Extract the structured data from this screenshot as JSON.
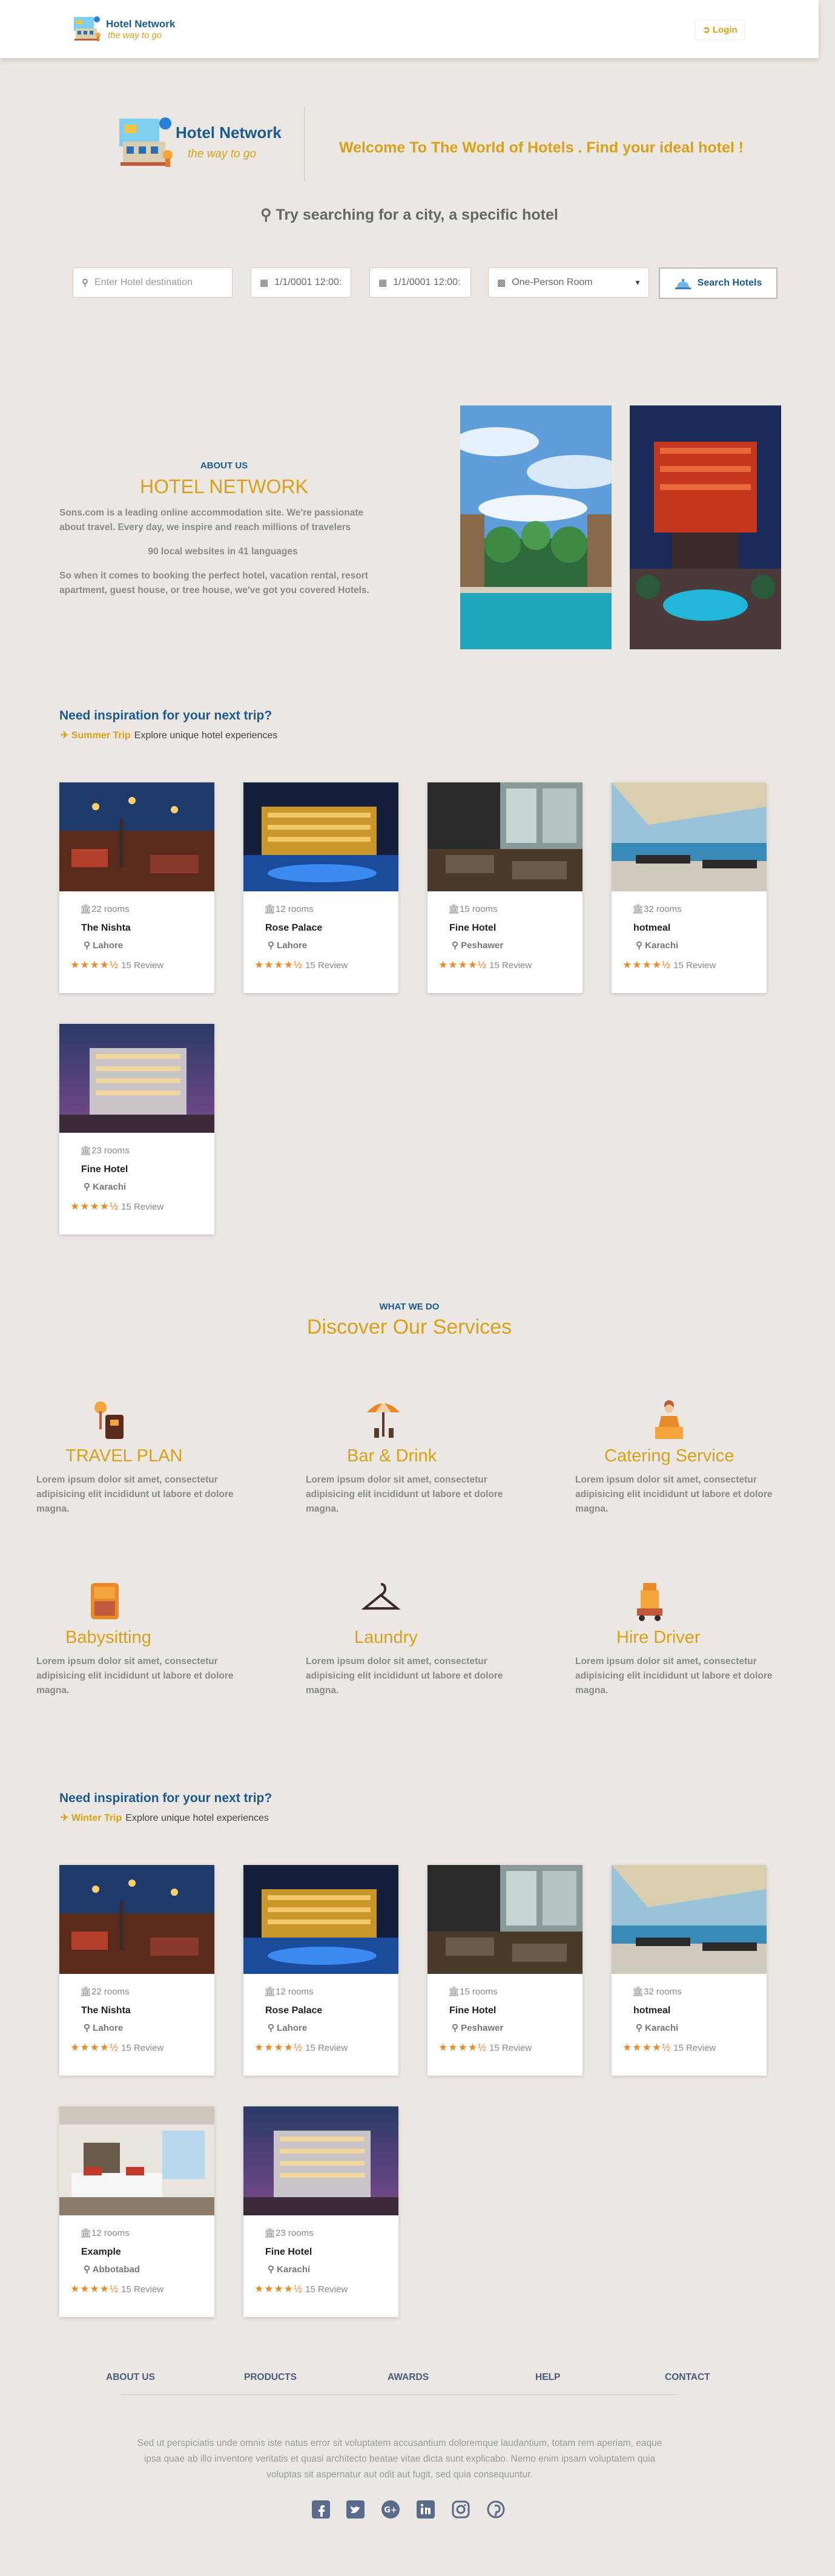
{
  "nav": {
    "brand": "Hotel Network",
    "tagline": "the way to go",
    "login_label": "Login"
  },
  "hero": {
    "brand": "Hotel Network",
    "tagline": "the way to go",
    "welcome": "Welcome To The World of Hotels . Find your ideal hotel !",
    "search_hint": "Try searching for a city, a specific hotel"
  },
  "search": {
    "destination_placeholder": "Enter Hotel destination",
    "checkin_value": "1/1/0001 12:00:",
    "checkout_value": "1/1/0001 12:00:",
    "room_type": "One-Person Room",
    "button_label": "Search Hotels"
  },
  "about": {
    "label": "ABOUT US",
    "title": "HOTEL NETWORK",
    "p1": "Sons.com is a leading online accommodation site. We're passionate about travel. Every day, we inspire and reach millions of travelers",
    "p2": "90 local websites in 41 languages",
    "p3": "So when it comes to booking the perfect hotel, vacation rental, resort apartment, guest house, or tree house, we've got you covered Hotels."
  },
  "summer": {
    "title": "Need inspiration for your next trip?",
    "tag": "Summer Trip",
    "subtitle": "Explore unique hotel experiences",
    "cards": [
      {
        "rooms": "22 rooms",
        "name": "The Nishta",
        "city": "Lahore",
        "reviews": "15 Review"
      },
      {
        "rooms": "12 rooms",
        "name": "Rose Palace",
        "city": "Lahore",
        "reviews": "15 Review"
      },
      {
        "rooms": "15 rooms",
        "name": "Fine Hotel",
        "city": "Peshawer",
        "reviews": "15 Review"
      },
      {
        "rooms": "32 rooms",
        "name": "hotmeal",
        "city": "Karachi",
        "reviews": "15 Review"
      },
      {
        "rooms": "23 rooms",
        "name": "Fine Hotel",
        "city": "Karachi",
        "reviews": "15 Review"
      }
    ]
  },
  "services": {
    "label": "WHAT WE DO",
    "title": "Discover Our Services",
    "items": [
      {
        "title": "TRAVEL PLAN",
        "text": "Lorem ipsum dolor sit amet, consectetur adipisicing elit incididunt ut labore et dolore magna."
      },
      {
        "title": "Bar & Drink",
        "text": "Lorem ipsum dolor sit amet, consectetur adipisicing elit incididunt ut labore et dolore magna."
      },
      {
        "title": "Catering Service",
        "text": "Lorem ipsum dolor sit amet, consectetur adipisicing elit incididunt ut labore et dolore magna."
      },
      {
        "title": "Babysitting",
        "text": "Lorem ipsum dolor sit amet, consectetur adipisicing elit incididunt ut labore et dolore magna."
      },
      {
        "title": "Laundry",
        "text": "Lorem ipsum dolor sit amet, consectetur adipisicing elit incididunt ut labore et dolore magna."
      },
      {
        "title": "Hire Driver",
        "text": "Lorem ipsum dolor sit amet, consectetur adipisicing elit incididunt ut labore et dolore magna."
      }
    ]
  },
  "winter": {
    "title": "Need inspiration for your next trip?",
    "tag": "Winter Trip",
    "subtitle": "Explore unique hotel experiences",
    "cards": [
      {
        "rooms": "22 rooms",
        "name": "The Nishta",
        "city": "Lahore",
        "reviews": "15 Review"
      },
      {
        "rooms": "12 rooms",
        "name": "Rose Palace",
        "city": "Lahore",
        "reviews": "15 Review"
      },
      {
        "rooms": "15 rooms",
        "name": "Fine Hotel",
        "city": "Peshawer",
        "reviews": "15 Review"
      },
      {
        "rooms": "32 rooms",
        "name": "hotmeal",
        "city": "Karachi",
        "reviews": "15 Review"
      },
      {
        "rooms": "12 rooms",
        "name": "Example",
        "city": "Abbotabad",
        "reviews": "15 Review"
      },
      {
        "rooms": "23 rooms",
        "name": "Fine Hotel",
        "city": "Karachi",
        "reviews": "15 Review"
      }
    ]
  },
  "footer": {
    "links": [
      "ABOUT US",
      "PRODUCTS",
      "AWARDS",
      "HELP",
      "CONTACT"
    ],
    "text": "Sed ut perspiciatis unde omnis iste natus error sit voluptatem accusantium doloremque laudantium, totam rem aperiam, eaque ipsa quae ab illo inventore veritatis et quasi architecto beatae vitae dicta sunt explicabo. Nemo enim ipsam voluptatem quia voluptas sit aspernatur aut odit aut fugit, sed quia consequuntur.",
    "social_icons": [
      "facebook-icon",
      "twitter-icon",
      "google-plus-icon",
      "linkedin-icon",
      "instagram-icon",
      "pinterest-icon"
    ]
  },
  "colors": {
    "brand_blue": "#1c5a8e",
    "accent_gold": "#d8a11a",
    "star_orange": "#e8892a",
    "background": "#ebe7e2"
  }
}
